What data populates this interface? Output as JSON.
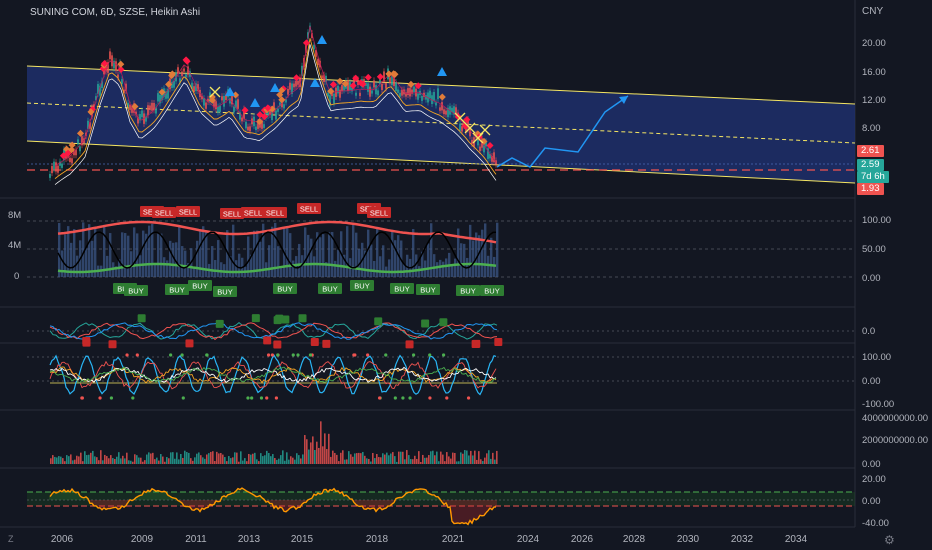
{
  "header": {
    "title": "SUNING COM, 6D, SZSE, Heikin Ashi",
    "currency": "CNY"
  },
  "price_axis": [
    "20.00",
    "16.00",
    "12.00",
    "8.00"
  ],
  "price_tags": {
    "p1": "2.61",
    "p2": "2.59",
    "p3": "7d 6h",
    "p4": "1.93"
  },
  "vol_left": [
    "8M",
    "4M",
    "0"
  ],
  "osc1_axis": [
    "100.00",
    "50.00",
    "0.00"
  ],
  "osc2_axis": [
    "0.0"
  ],
  "osc3_axis": [
    "100.00",
    "0.00",
    "-100.00"
  ],
  "osc4_axis": [
    "4000000000.00",
    "2000000000.00",
    "0.00"
  ],
  "osc5_axis": [
    "20.00",
    "0.00",
    "-40.00"
  ],
  "signals": {
    "sell": "SELL",
    "buy": "BUY"
  },
  "time_axis": [
    "2006",
    "2009",
    "2011",
    "2013",
    "2015",
    "2018",
    "2021",
    "2024",
    "2026",
    "2028",
    "2030",
    "2032",
    "2034"
  ],
  "colors": {
    "bg": "#131722",
    "up": "#26a69a",
    "down": "#ef5350",
    "channel": "#f5e663",
    "accent": "#2196f3"
  }
}
